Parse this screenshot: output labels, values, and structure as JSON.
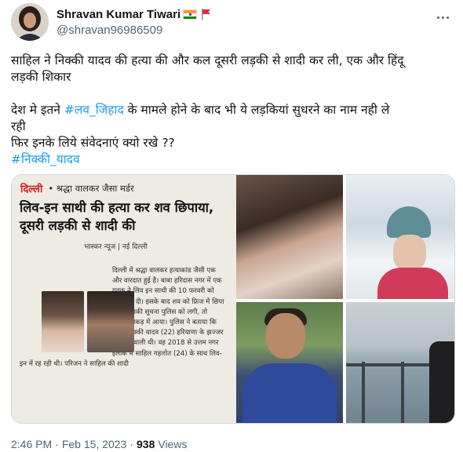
{
  "author": {
    "name": "Shravan Kumar Tiwari",
    "handle": "@shravan96986509"
  },
  "tweet": {
    "lines": [
      "साहिल ने निक्की यादव की हत्या की और कल दूसरी लड़की से शादी कर ली, एक और हिंदू",
      "लड़की शिकार"
    ],
    "line2_prefix": "देश मे इतने ",
    "hashtag1": "#लव_जिहाद",
    "line2_suffix": " के मामले होने के बाद भी ये लड़कियां सुधरने का नाम नही ले",
    "line3": "रही",
    "line4": "फिर इनके लिये संवेदनाएं क्यो रखे  ??",
    "hashtag2": "#निक्की_यादव"
  },
  "clipping": {
    "place": "दिल्ली",
    "kicker": "• श्रद्धा वालकर जैसा मर्डर",
    "headline": "लिव-इन साथी की हत्या कर शव छिपाया, दूसरी लड़की से शादी की",
    "byline": "भास्कर न्यूज | नई दिल्ली",
    "body": "दिल्ली में श्रद्धा वालकर हत्याकांड जैसी एक और वारदात हुई है। बाबा हरिदास नगर में एक युवक ने लिव इन साथी की 10 फरवरी को हत्या कर दी। इसके बाद शव को फ्रिज में छिपा दिया। इसकी सूचना पुलिस को लगी, तो आरोपी पकड़ में आया। पुलिस ने बताया कि मृतक निक्की यादव (22) हरियाणा के झज्जर की रहने वाली थी। वह 2018 से उत्तम नगर इलाके में साहिल गहलोत (24) के साथ लिव-इन में रह रही थी। परिजन ने साहिल की शादी"
  },
  "meta": {
    "time": "2:46 PM",
    "separator1": "·",
    "date": "Feb 15, 2023",
    "separator2": "·",
    "views_count": "938",
    "views_label": "Views"
  },
  "colors": {
    "accent": "#1d9bf0",
    "text": "#0f1419",
    "muted": "#536471"
  }
}
